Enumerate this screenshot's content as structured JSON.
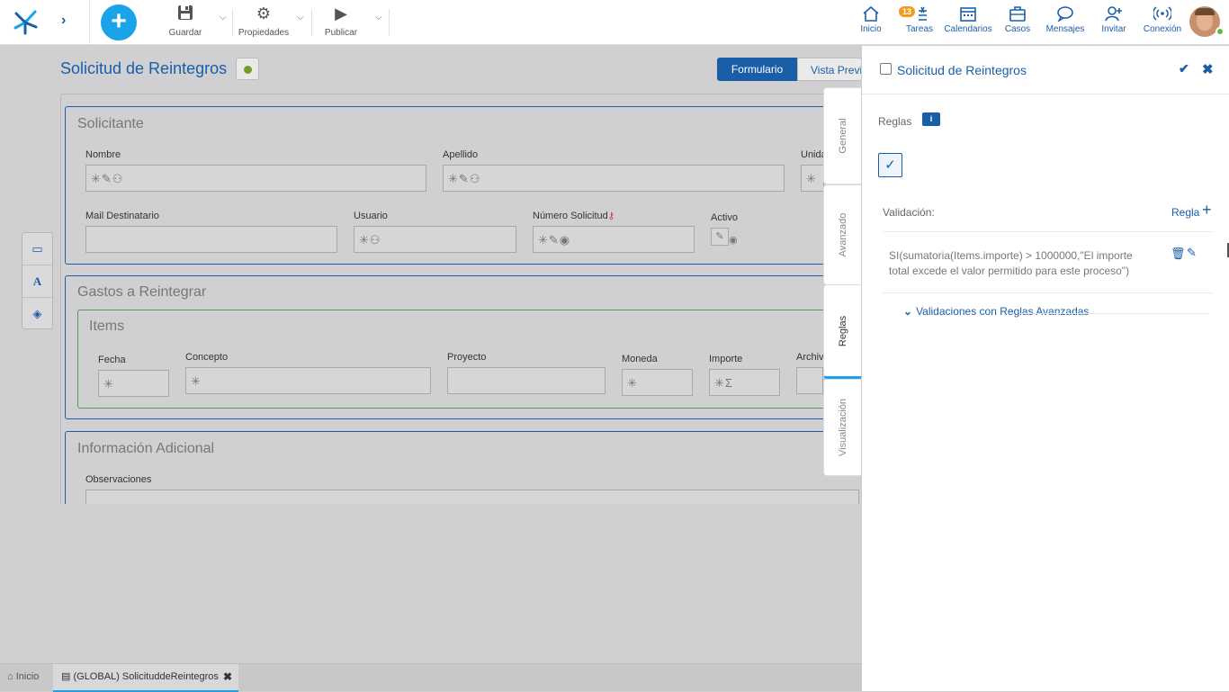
{
  "toolbar": {
    "save_label": "Guardar",
    "properties_label": "Propiedades",
    "publish_label": "Publicar"
  },
  "nav": {
    "inicio": "Inicio",
    "tareas": "Tareas",
    "tareas_badge": "13",
    "calendarios": "Calendarios",
    "casos": "Casos",
    "mensajes": "Mensajes",
    "invitar": "Invitar",
    "conexion": "Conexión"
  },
  "form": {
    "title": "Solicitud de Reintegros",
    "view_form": "Formulario",
    "view_preview": "Vista Previa",
    "sections": {
      "solicitante": "Solicitante",
      "gastos": "Gastos a Reintegrar",
      "items": "Items",
      "info": "Información Adicional"
    },
    "fields": {
      "nombre": "Nombre",
      "apellido": "Apellido",
      "unidad": "Unidad",
      "mail": "Mail Destinatario",
      "usuario": "Usuario",
      "numero": "Número Solicitud",
      "activo": "Activo",
      "fecha": "Fecha",
      "concepto": "Concepto",
      "proyecto": "Proyecto",
      "moneda": "Moneda",
      "importe": "Importe",
      "archivo": "Archivo",
      "observaciones": "Observaciones"
    }
  },
  "side_tabs": {
    "general": "General",
    "avanzado": "Avanzado",
    "reglas": "Reglas",
    "visualizacion": "Visualización"
  },
  "panel": {
    "title": "Solicitud de Reintegros",
    "reglas_label": "Reglas",
    "validacion_label": "Validación:",
    "add_rule_label": "Regla",
    "rule_text": "SI(sumatoria(Items.importe) > 1000000,\"El importe total excede el valor permitido para este proceso\")",
    "advanced_label": "Validaciones con Reglas Avanzadas"
  },
  "bottom": {
    "inicio": "Inicio",
    "tab": "(GLOBAL) SolicituddeReintegros"
  },
  "colors": {
    "primary": "#1a5ea8",
    "accent": "#1aa3e8",
    "badge": "#f29c1f",
    "items_border": "#5a9a4a"
  }
}
